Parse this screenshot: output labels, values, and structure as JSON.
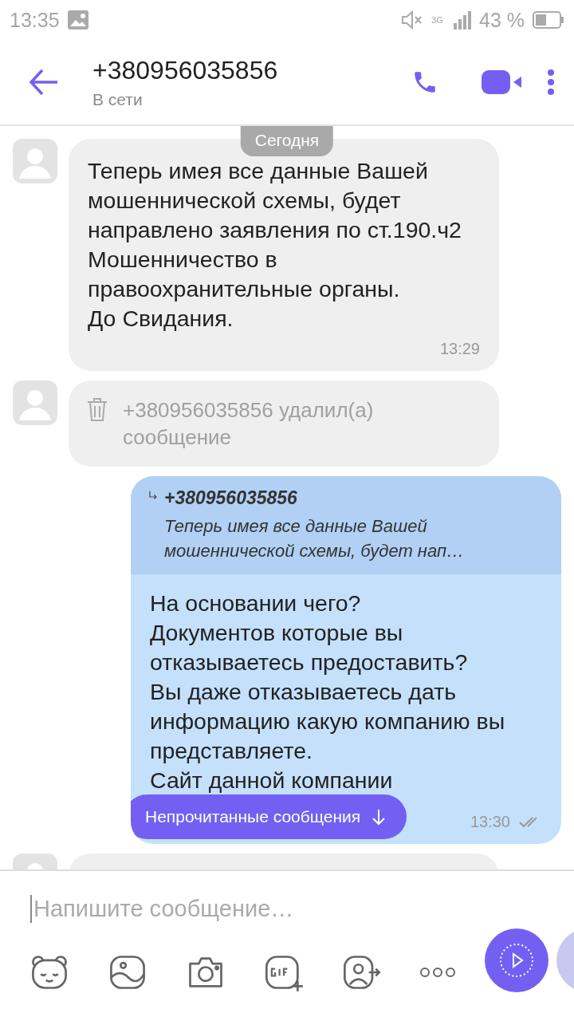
{
  "status_bar": {
    "time": "13:35",
    "network": "3G",
    "battery": "43 %"
  },
  "header": {
    "title": "+380956035856",
    "subtitle": "В сети"
  },
  "date_chip": "Сегодня",
  "messages": [
    {
      "kind": "incoming",
      "text": "Теперь имея все данные Вашей мошеннической схемы, будет направлено заявления по ст.190.ч2 Мошенничество в правоохранительные органы.\nДо Свидания.",
      "time": "13:29"
    },
    {
      "kind": "deleted",
      "text": "+380956035856 удалил(а) сообщение"
    },
    {
      "kind": "outgoing",
      "quote": {
        "author": "+380956035856",
        "text": "Теперь имея все данные Вашей мошеннической схемы, будет нап…"
      },
      "text": "На основании чего?\nДокументов которые вы отказываетесь предоставить?\nВы даже отказываетесь дать информацию какую компанию вы представляете.\nСайт данной компании",
      "time": "13:30",
      "read": true
    },
    {
      "kind": "peek"
    }
  ],
  "unread_button": "Непрочитанные сообщения",
  "composer": {
    "placeholder": "Напишите сообщение…"
  }
}
